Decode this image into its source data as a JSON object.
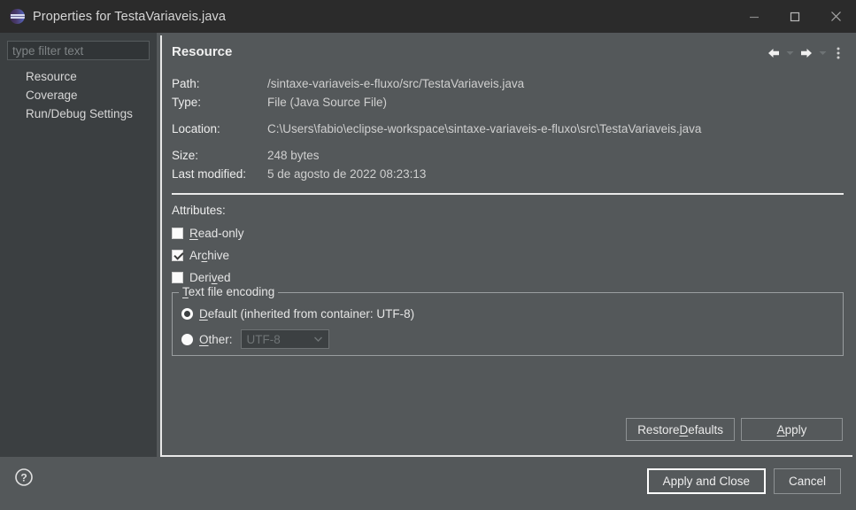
{
  "window": {
    "title": "Properties for TestaVariaveis.java",
    "app_icon": "eclipse-icon",
    "controls": {
      "minimize": "minimize-icon",
      "maximize": "maximize-icon",
      "close": "close-icon"
    }
  },
  "sidebar": {
    "filter": {
      "placeholder": "type filter text",
      "value": ""
    },
    "items": [
      {
        "label": "Resource"
      },
      {
        "label": "Coverage"
      },
      {
        "label": "Run/Debug Settings"
      }
    ]
  },
  "content": {
    "title": "Resource",
    "toolbar": {
      "back": "back-arrow-icon",
      "back_menu": "chevron-down-icon",
      "forward": "forward-arrow-icon",
      "forward_menu": "chevron-down-icon",
      "more": "more-vertical-icon"
    },
    "fields": [
      {
        "label": "Path:",
        "value": "/sintaxe-variaveis-e-fluxo/src/TestaVariaveis.java"
      },
      {
        "label": "Type:",
        "value": "File  (Java Source File)"
      },
      {
        "label": "Location:",
        "value": "C:\\Users\\fabio\\eclipse-workspace\\sintaxe-variaveis-e-fluxo\\src\\TestaVariaveis.java"
      },
      {
        "label": "Size:",
        "value": "248  bytes"
      },
      {
        "label": "Last modified:",
        "value": "5 de agosto de 2022 08:23:13"
      }
    ],
    "location_button_icon": "open-file-icon",
    "attributes": {
      "title": "Attributes:",
      "items": [
        {
          "label_pre": "",
          "label_mnemonic": "R",
          "label_post": "ead-only",
          "checked": false
        },
        {
          "label_pre": "Ar",
          "label_mnemonic": "c",
          "label_post": "hive",
          "checked": true
        },
        {
          "label_pre": "Deri",
          "label_mnemonic": "v",
          "label_post": "ed",
          "checked": false
        }
      ]
    },
    "encoding": {
      "legend_pre": "",
      "legend_mnemonic": "T",
      "legend_post": "ext file encoding",
      "default_option": {
        "label_pre": "",
        "label_mnemonic": "D",
        "label_post": "efault (inherited from container: UTF-8)",
        "selected": true
      },
      "other_option": {
        "label_pre": "",
        "label_mnemonic": "O",
        "label_post": "ther:",
        "selected": false,
        "combo_value": "UTF-8",
        "combo_arrow_icon": "chevron-down-icon",
        "disabled": true
      }
    },
    "buttons": {
      "restore_defaults_pre": "Restore ",
      "restore_defaults_mnemonic": "D",
      "restore_defaults_post": "efaults",
      "apply_pre": "",
      "apply_mnemonic": "A",
      "apply_post": "pply"
    }
  },
  "footer": {
    "help_icon": "help-icon",
    "apply_and_close": "Apply and Close",
    "cancel": "Cancel"
  },
  "colors": {
    "titlebar_bg": "#2b2b2b",
    "sidebar_bg": "#3b3f41",
    "content_bg": "#54585a",
    "text": "#e6e6e6",
    "muted_text": "#cfcfcf",
    "border": "#8e9294"
  }
}
